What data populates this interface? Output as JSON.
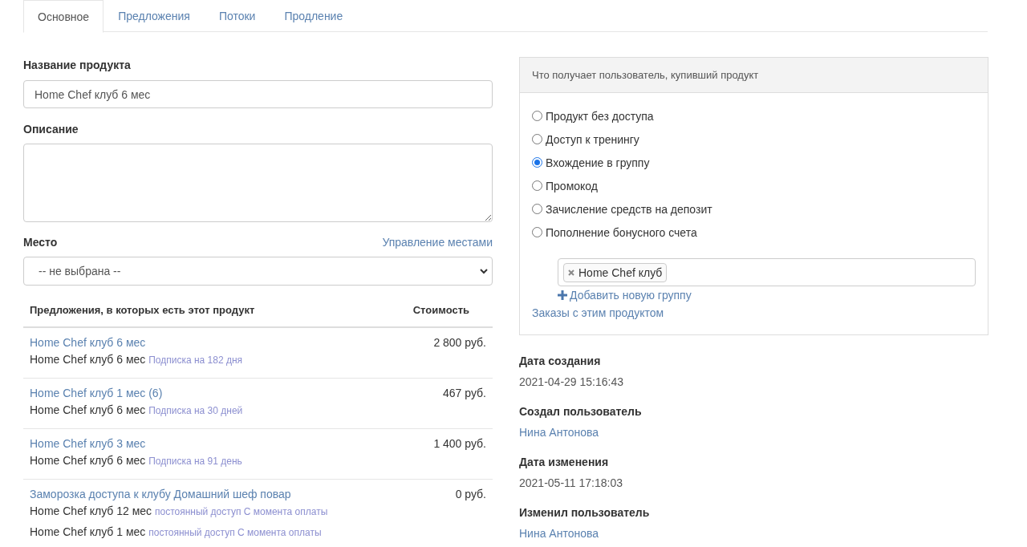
{
  "tabs": [
    {
      "label": "Основное",
      "selected": true
    },
    {
      "label": "Предложения",
      "selected": false
    },
    {
      "label": "Потоки",
      "selected": false
    },
    {
      "label": "Продление",
      "selected": false
    }
  ],
  "product_name": {
    "label": "Название продукта",
    "value": "Home Chef клуб 6 мес"
  },
  "description": {
    "label": "Описание"
  },
  "place": {
    "label": "Место",
    "manage_link": "Управление местами",
    "value": "-- не выбрана --"
  },
  "offers": {
    "columns": [
      "Предложения, в которых есть этот продукт",
      "Стоимость"
    ],
    "rows": [
      {
        "title": "Home Chef клуб 6 мес",
        "price": "2 800 руб.",
        "items": [
          {
            "name": "Home Chef клуб 6 мес",
            "note": "Подписка на 182 дня"
          }
        ]
      },
      {
        "title": "Home Chef клуб 1 мес (6)",
        "price": "467 руб.",
        "items": [
          {
            "name": "Home Chef клуб 6 мес",
            "note": "Подписка на 30 дней"
          }
        ]
      },
      {
        "title": "Home Chef клуб 3 мес",
        "price": "1 400 руб.",
        "items": [
          {
            "name": "Home Chef клуб 6 мес",
            "note": "Подписка на 91 день"
          }
        ]
      },
      {
        "title": "Заморозка доступа к клубу Домашний шеф повар",
        "price": "0 руб.",
        "items": [
          {
            "name": "Home Chef клуб 12 мес",
            "note": "постоянный доступ С момента оплаты"
          },
          {
            "name": "Home Chef клуб 1 мес",
            "note": "постоянный доступ С момента оплаты"
          }
        ]
      }
    ]
  },
  "access_panel": {
    "title": "Что получает пользователь, купивший продукт",
    "options": [
      {
        "label": "Продукт без доступа",
        "selected": false
      },
      {
        "label": "Доступ к тренингу",
        "selected": false
      },
      {
        "label": "Вхождение в группу",
        "selected": true
      },
      {
        "label": "Промокод",
        "selected": false
      },
      {
        "label": "Зачисление средств на депозит",
        "selected": false
      },
      {
        "label": "Пополнение бонусного счета",
        "selected": false
      }
    ],
    "groups": [
      "Home Chef клуб"
    ],
    "add_group": "Добавить новую группу",
    "orders_link": "Заказы с этим продуктом"
  },
  "meta": [
    {
      "label": "Дата создания",
      "value": "2021-04-29 15:16:43",
      "kind": "text"
    },
    {
      "label": "Создал пользователь",
      "value": "Нина Антонова",
      "kind": "link"
    },
    {
      "label": "Дата изменения",
      "value": "2021-05-11 17:18:03",
      "kind": "text"
    },
    {
      "label": "Изменил пользователь",
      "value": "Нина Антонова",
      "kind": "link"
    }
  ]
}
